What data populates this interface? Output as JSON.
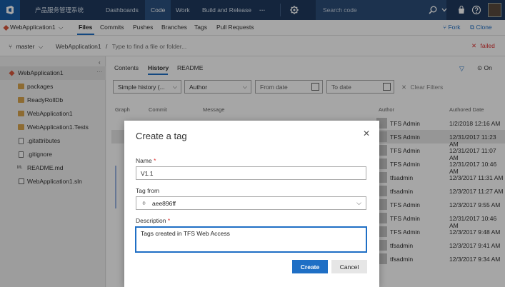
{
  "topnav": {
    "project": "产品服务管理系统",
    "items": [
      "Dashboards",
      "Code",
      "Work",
      "Build and Release"
    ],
    "more": "···",
    "search_placeholder": "Search code"
  },
  "hub": {
    "repo": "WebApplication1",
    "tabs": [
      "Files",
      "Commits",
      "Pushes",
      "Branches",
      "Tags",
      "Pull Requests"
    ],
    "fork": "Fork",
    "clone": "Clone"
  },
  "path": {
    "branch": "master",
    "repo": "WebApplication1",
    "placeholder": "Type to find a file or folder...",
    "status": "failed"
  },
  "tree": {
    "root": "WebApplication1",
    "items": [
      {
        "label": "packages",
        "type": "folder"
      },
      {
        "label": "ReadyRollDb",
        "type": "folder"
      },
      {
        "label": "WebApplication1",
        "type": "folder"
      },
      {
        "label": "WebApplication1.Tests",
        "type": "folder"
      },
      {
        "label": ".gitattributes",
        "type": "file"
      },
      {
        "label": ".gitignore",
        "type": "file"
      },
      {
        "label": "README.md",
        "type": "file"
      },
      {
        "label": "WebApplication1.sln",
        "type": "file"
      }
    ]
  },
  "content": {
    "tabs": [
      "Contents",
      "History",
      "README"
    ],
    "on_label": "On",
    "filters": {
      "history": "Simple history (...",
      "author": "Author",
      "from": "From date",
      "to": "To date",
      "clear": "Clear Filters"
    },
    "columns": [
      "Graph",
      "Commit",
      "Message",
      "Author",
      "Authored Date"
    ],
    "rows": [
      {
        "author": "TFS Admin",
        "date": "1/2/2018 12:16 AM"
      },
      {
        "author": "TFS Admin",
        "date": "12/31/2017 11:23 AM"
      },
      {
        "author": "TFS Admin",
        "date": "12/31/2017 11:07 AM"
      },
      {
        "author": "TFS Admin",
        "date": "12/31/2017 10:46 AM"
      },
      {
        "author": "tfsadmin",
        "date": "12/3/2017 11:31 AM"
      },
      {
        "author": "tfsadmin",
        "date": "12/3/2017 11:27 AM"
      },
      {
        "author": "TFS Admin",
        "date": "12/3/2017 9:55 AM"
      },
      {
        "author": "TFS Admin",
        "date": "12/31/2017 10:46 AM"
      },
      {
        "author": "TFS Admin",
        "date": "12/3/2017 9:48 AM"
      },
      {
        "author": "tfsadmin",
        "date": "12/3/2017 9:41 AM"
      },
      {
        "author": "tfsadmin",
        "date": "12/3/2017 9:34 AM"
      }
    ]
  },
  "dialog": {
    "title": "Create a tag",
    "name_label": "Name",
    "name_value": "V1.1",
    "tagfrom_label": "Tag from",
    "tagfrom_value": "aee896ff",
    "description_label": "Description",
    "description_value": "Tags created in TFS Web Access",
    "required_mark": "*",
    "create": "Create",
    "cancel": "Cancel"
  }
}
